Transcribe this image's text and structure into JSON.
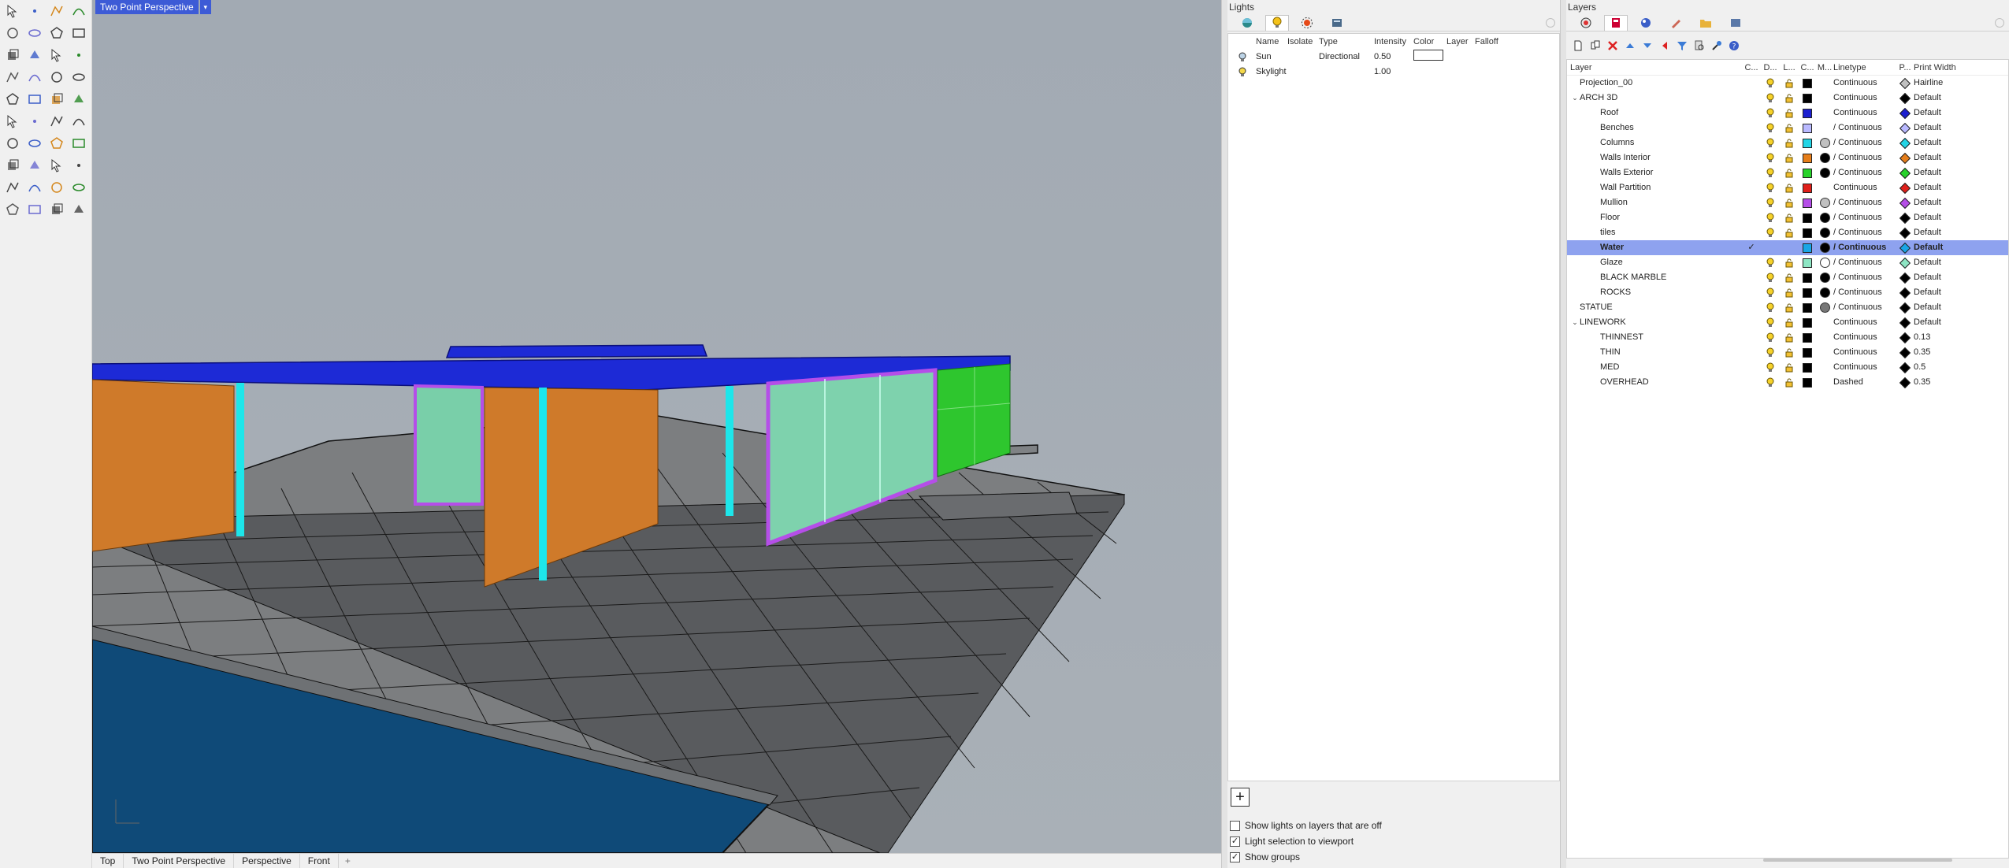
{
  "viewport": {
    "title": "Two Point Perspective",
    "menu_glyph": "▾",
    "tabs": [
      "Top",
      "Two Point Perspective",
      "Perspective",
      "Front"
    ],
    "add_tab_glyph": "+"
  },
  "lights_panel": {
    "title": "Lights",
    "columns": [
      "Name",
      "Isolate",
      "Type",
      "Intensity",
      "Color",
      "Layer",
      "Falloff"
    ],
    "rows": [
      {
        "name": "Sun",
        "isolate": "",
        "type": "Directional",
        "intensity": "0.50",
        "color": "#ffffff",
        "layer": "",
        "falloff": ""
      },
      {
        "name": "Skylight",
        "isolate": "",
        "type": "",
        "intensity": "1.00",
        "color": "",
        "layer": "",
        "falloff": ""
      }
    ],
    "add_glyph": "+",
    "options": [
      {
        "label": "Show lights on layers that are off",
        "checked": false
      },
      {
        "label": "Light selection to viewport",
        "checked": true
      },
      {
        "label": "Show groups",
        "checked": true
      }
    ]
  },
  "layers_panel": {
    "title": "Layers",
    "columns": {
      "layer": "Layer",
      "current": "C...",
      "on": "D...",
      "lock": "L...",
      "color": "C...",
      "material": "M...",
      "linetype": "Linetype",
      "print_color": "P...",
      "print_width": "Print Width"
    },
    "rows": [
      {
        "name": "Projection_00",
        "indent": 0,
        "expander": "",
        "current": "",
        "color": "#000000",
        "material": "",
        "linetype": "Continuous",
        "print_color": "#c0c0c0",
        "print_width": "Hairline",
        "selected": false
      },
      {
        "name": "ARCH 3D",
        "indent": 0,
        "expander": "⌄",
        "current": "",
        "color": "#000000",
        "material": "",
        "linetype": "Continuous",
        "print_color": "#000000",
        "print_width": "Default",
        "selected": false
      },
      {
        "name": "Roof",
        "indent": 1,
        "expander": "",
        "current": "",
        "color": "#1c1fd0",
        "material": "",
        "linetype": "Continuous",
        "print_color": "#1c1fd0",
        "print_width": "Default",
        "selected": false
      },
      {
        "name": "Benches",
        "indent": 1,
        "expander": "",
        "current": "",
        "color": "#b9b9ff",
        "material": "",
        "linetype": "/ Continuous",
        "print_color": "#b9b9ff",
        "print_width": "Default",
        "selected": false
      },
      {
        "name": "Columns",
        "indent": 1,
        "expander": "",
        "current": "",
        "color": "#22d5e6",
        "material": "#c0c0c0",
        "linetype": "/ Continuous",
        "print_color": "#22d5e6",
        "print_width": "Default",
        "selected": false
      },
      {
        "name": "Walls Interior",
        "indent": 1,
        "expander": "",
        "current": "",
        "color": "#e57d1a",
        "material": "#000000",
        "linetype": "/ Continuous",
        "print_color": "#e57d1a",
        "print_width": "Default",
        "selected": false
      },
      {
        "name": "Walls Exterior",
        "indent": 1,
        "expander": "",
        "current": "",
        "color": "#27d32a",
        "material": "#000000",
        "linetype": "/ Continuous",
        "print_color": "#27d32a",
        "print_width": "Default",
        "selected": false
      },
      {
        "name": "Wall Partition",
        "indent": 1,
        "expander": "",
        "current": "",
        "color": "#e0201b",
        "material": "",
        "linetype": "Continuous",
        "print_color": "#e0201b",
        "print_width": "Default",
        "selected": false
      },
      {
        "name": "Mullion",
        "indent": 1,
        "expander": "",
        "current": "",
        "color": "#b54ee8",
        "material": "#c0c0c0",
        "linetype": "/ Continuous",
        "print_color": "#b54ee8",
        "print_width": "Default",
        "selected": false
      },
      {
        "name": "Floor",
        "indent": 1,
        "expander": "",
        "current": "",
        "color": "#000000",
        "material": "#000000",
        "linetype": "/ Continuous",
        "print_color": "#000000",
        "print_width": "Default",
        "selected": false
      },
      {
        "name": "tiles",
        "indent": 1,
        "expander": "",
        "current": "",
        "color": "#000000",
        "material": "#000000",
        "linetype": "/ Continuous",
        "print_color": "#000000",
        "print_width": "Default",
        "selected": false
      },
      {
        "name": "Water",
        "indent": 1,
        "expander": "",
        "current": "✓",
        "color": "#1aa6e6",
        "material": "#000000",
        "linetype": "/ Continuous",
        "print_color": "#1aa6e6",
        "print_width": "Default",
        "selected": true
      },
      {
        "name": "Glaze",
        "indent": 1,
        "expander": "",
        "current": "",
        "color": "#8ee6c4",
        "material": "#ffffff",
        "linetype": "/ Continuous",
        "print_color": "#8ee6c4",
        "print_width": "Default",
        "selected": false
      },
      {
        "name": "BLACK MARBLE",
        "indent": 1,
        "expander": "",
        "current": "",
        "color": "#000000",
        "material": "#000000",
        "linetype": "/ Continuous",
        "print_color": "#000000",
        "print_width": "Default",
        "selected": false
      },
      {
        "name": "ROCKS",
        "indent": 1,
        "expander": "",
        "current": "",
        "color": "#000000",
        "material": "#000000",
        "linetype": "/ Continuous",
        "print_color": "#000000",
        "print_width": "Default",
        "selected": false
      },
      {
        "name": "STATUE",
        "indent": 0,
        "expander": "",
        "current": "",
        "color": "#000000",
        "material": "#777777",
        "linetype": "/ Continuous",
        "print_color": "#000000",
        "print_width": "Default",
        "selected": false
      },
      {
        "name": "LINEWORK",
        "indent": 0,
        "expander": "⌄",
        "current": "",
        "color": "#000000",
        "material": "",
        "linetype": "Continuous",
        "print_color": "#000000",
        "print_width": "Default",
        "selected": false
      },
      {
        "name": "THINNEST",
        "indent": 1,
        "expander": "",
        "current": "",
        "color": "#000000",
        "material": "",
        "linetype": "Continuous",
        "print_color": "#000000",
        "print_width": "0.13",
        "selected": false
      },
      {
        "name": "THIN",
        "indent": 1,
        "expander": "",
        "current": "",
        "color": "#000000",
        "material": "",
        "linetype": "Continuous",
        "print_color": "#000000",
        "print_width": "0.35",
        "selected": false
      },
      {
        "name": "MED",
        "indent": 1,
        "expander": "",
        "current": "",
        "color": "#000000",
        "material": "",
        "linetype": "Continuous",
        "print_color": "#000000",
        "print_width": "0.5",
        "selected": false
      },
      {
        "name": "OVERHEAD",
        "indent": 1,
        "expander": "",
        "current": "",
        "color": "#000000",
        "material": "",
        "linetype": "Dashed",
        "print_color": "#000000",
        "print_width": "0.35",
        "selected": false
      }
    ]
  },
  "toolbar_icons": [
    "select-arrow-icon",
    "point-icon",
    "polyline-icon",
    "curve-icon",
    "circle-icon",
    "ellipse-icon",
    "polygon-icon",
    "rectangle-icon",
    "arc-icon",
    "fillet-icon",
    "surface-icon",
    "extrude-icon",
    "box-icon",
    "sphere-icon",
    "cylinder-icon",
    "solid-edit-icon",
    "boolean-icon",
    "explode-icon",
    "join-icon",
    "trim-icon",
    "gumball-icon",
    "control-points-icon",
    "rotate-icon",
    "scale-icon",
    "move-icon",
    "array-icon",
    "mirror-icon",
    "align-icon",
    "dimension-icon",
    "text-icon",
    "grid-icon",
    "analyze-icon",
    "mesh-icon",
    "render-icon",
    "check-icon",
    "layer-icon",
    "paint-icon",
    "light-icon",
    "camera-icon",
    "settings-icon"
  ]
}
